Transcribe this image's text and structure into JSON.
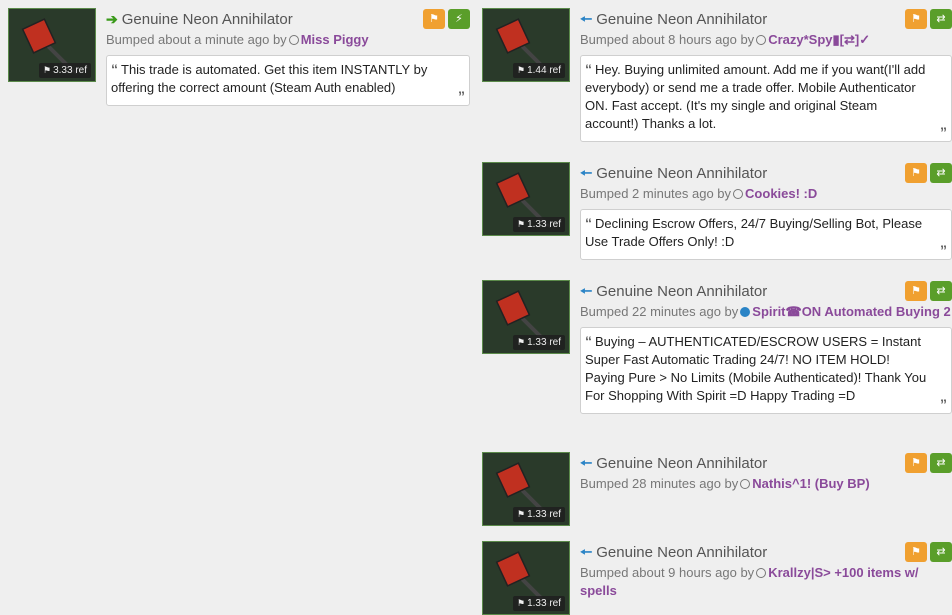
{
  "left_listings": [
    {
      "title": "Genuine Neon Annihilator",
      "price": "3.33 ref",
      "bumped": "Bumped about a minute ago by",
      "user": "Miss Piggy",
      "description": "This trade is automated. Get this item INSTANTLY by offering the correct amount (Steam Auth enabled)",
      "direction": "arrow-right-icon",
      "action": "lightning-icon"
    }
  ],
  "right_listings": [
    {
      "title": "Genuine Neon Annihilator",
      "price": "1.44 ref",
      "bumped": "Bumped about 8 hours ago by",
      "user": "Crazy*Spy▮[⇄]✓",
      "description": "Hey. Buying unlimited amount. Add me if you want(I'll add everybody) or send me a trade offer. Mobile Authenticator ON. Fast accept. (It's my single and original Steam account!) Thanks a lot."
    },
    {
      "title": "Genuine Neon Annihilator",
      "price": "1.33 ref",
      "bumped": "Bumped 2 minutes ago by",
      "user": "Cookies! :D",
      "description": "Declining Escrow Offers, 24/7 Buying/Selling Bot, Please Use Trade Offers Only! :D"
    },
    {
      "title": "Genuine Neon Annihilator",
      "price": "1.33 ref",
      "bumped": "Bumped 22 minutes ago by",
      "user": "Spirit☎ON Automated Buying 2",
      "description": "Buying – AUTHENTICATED/ESCROW USERS = Instant Super Fast Automatic Trading 24/7! NO ITEM HOLD! Paying Pure > No Limits (Mobile Authenticated)! Thank You For Shopping With Spirit =D Happy Trading =D"
    },
    {
      "title": "Genuine Neon Annihilator",
      "price": "1.33 ref",
      "bumped": "Bumped 28 minutes ago by",
      "user": "Nathis^1! (Buy BP)"
    },
    {
      "title": "Genuine Neon Annihilator",
      "price": "1.33 ref",
      "bumped": "Bumped about 9 hours ago by",
      "user": "Krallzy|S> +100 items w/ spells"
    }
  ],
  "colors": {
    "flag_button": "#f0a030",
    "trade_button": "#5a9e2a",
    "username": "#8a4a9a",
    "sell_arrow": "#3a9a1a",
    "buy_arrow": "#2b84c6"
  }
}
